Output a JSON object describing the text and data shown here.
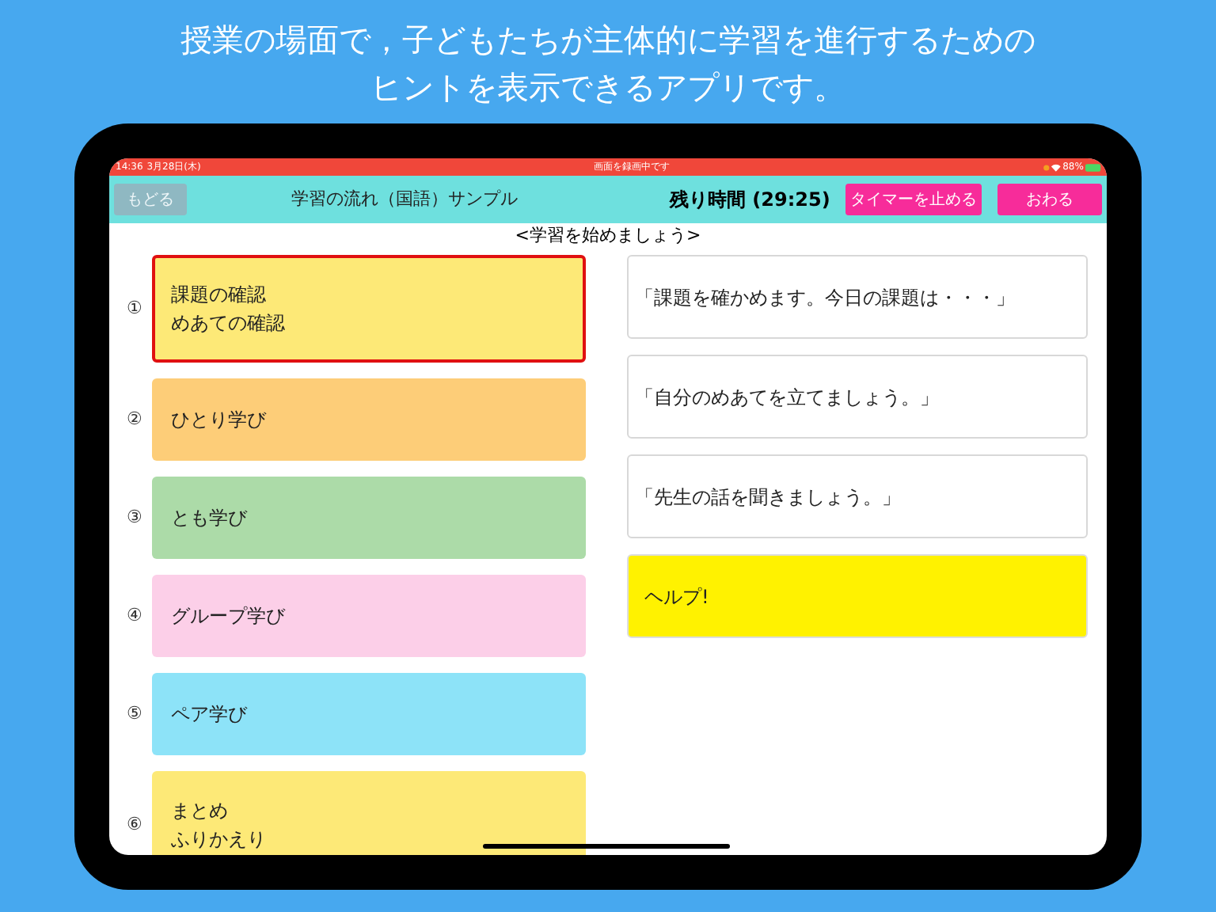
{
  "headline": [
    "授業の場面で，子どもたちが主体的に学習を進行するための",
    "ヒントを表示できるアプリです。"
  ],
  "status_bar": {
    "time": "14:36",
    "date": "3月28日(木)",
    "notice": "画面を録画中です",
    "battery": "88%"
  },
  "toolbar": {
    "back_button": {
      "label": "もどる",
      "disabled": true
    },
    "title": "学習の流れ（国語）サンプル",
    "timer": "残り時間 (29:25)",
    "stop_button": "タイマーを止める",
    "end_button": "おわる"
  },
  "subtitle": "<学習を始めましょう>",
  "steps": [
    {
      "number": "①",
      "lines": [
        "課題の確認",
        "めあての確認"
      ],
      "color": "#fde977",
      "selected": true
    },
    {
      "number": "②",
      "lines": [
        "ひとり学び"
      ],
      "color": "#fdcd78",
      "selected": false
    },
    {
      "number": "③",
      "lines": [
        "とも学び"
      ],
      "color": "#acdba8",
      "selected": false
    },
    {
      "number": "④",
      "lines": [
        "グループ学び"
      ],
      "color": "#fccfe8",
      "selected": false
    },
    {
      "number": "⑤",
      "lines": [
        "ペア学び"
      ],
      "color": "#8de3f8",
      "selected": false
    },
    {
      "number": "⑥",
      "lines": [
        "まとめ",
        "ふりかえり"
      ],
      "color": "#fde977",
      "selected": false
    }
  ],
  "hints": [
    {
      "kind": "hint",
      "text": "「課題を確かめます。今日の課題は・・・」"
    },
    {
      "kind": "hint",
      "text": "「自分のめあてを立てましょう。」"
    },
    {
      "kind": "hint",
      "text": "「先生の話を聞きましょう。」"
    },
    {
      "kind": "help",
      "text": "ヘルプ!"
    }
  ]
}
